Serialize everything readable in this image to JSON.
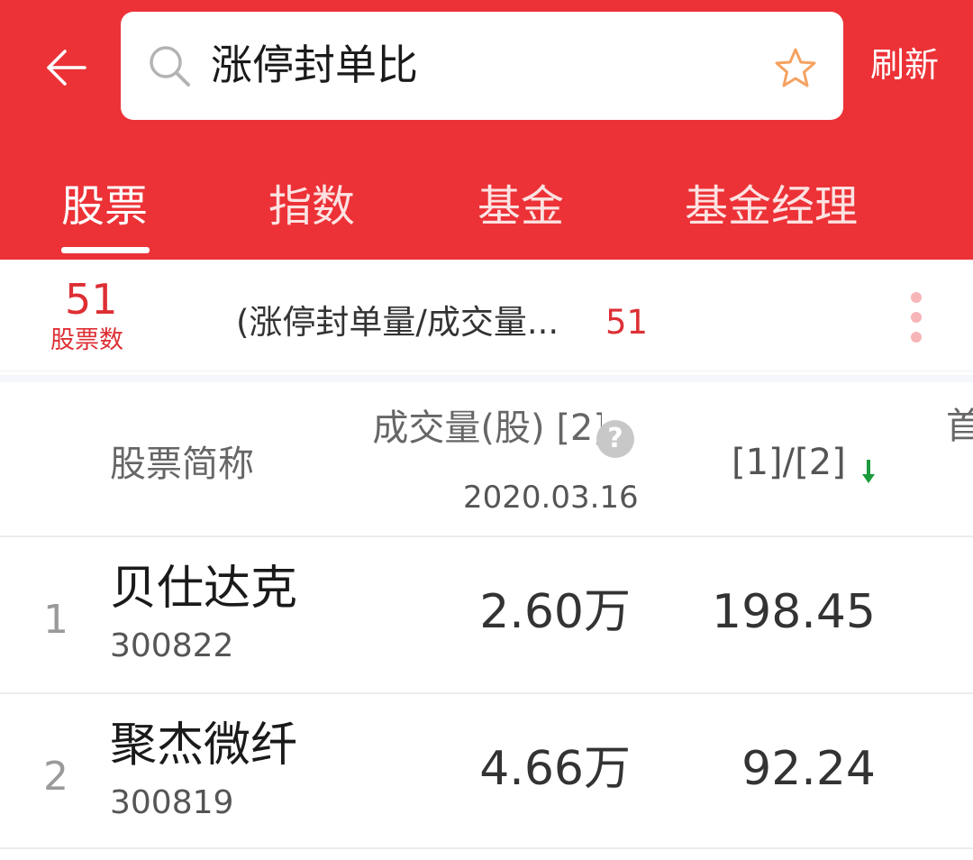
{
  "search": {
    "query": "涨停封单比"
  },
  "header": {
    "refresh_label": "刷新"
  },
  "tabs": [
    {
      "label": "股票",
      "active": true
    },
    {
      "label": "指数",
      "active": false
    },
    {
      "label": "基金",
      "active": false
    },
    {
      "label": "基金经理",
      "active": false
    }
  ],
  "summary": {
    "stock_count": "51",
    "stock_count_label": "股票数",
    "condition_text": "(涨停封单量/成交量...",
    "condition_count": "51"
  },
  "table": {
    "headers": {
      "name": "股票简称",
      "volume": "成交量(股) [2]",
      "volume_help": "?",
      "volume_date": "2020.03.16",
      "ratio": "[1]/[2]",
      "next": "首"
    },
    "rows": [
      {
        "index": "1",
        "name": "贝仕达克",
        "code": "300822",
        "volume": "2.60万",
        "ratio": "198.45"
      },
      {
        "index": "2",
        "name": "聚杰微纤",
        "code": "300819",
        "volume": "4.66万",
        "ratio": "92.24"
      }
    ]
  },
  "icons": {
    "back": "arrow-left-icon",
    "search": "search-icon",
    "favorite": "star-outline-icon",
    "more": "more-vertical-icon",
    "sort": "arrow-down-icon"
  },
  "colors": {
    "header_bg": "#ec3237",
    "accent_red": "#dd2f34",
    "star": "#f4a261",
    "sort_arrow": "#1a9a3c"
  }
}
